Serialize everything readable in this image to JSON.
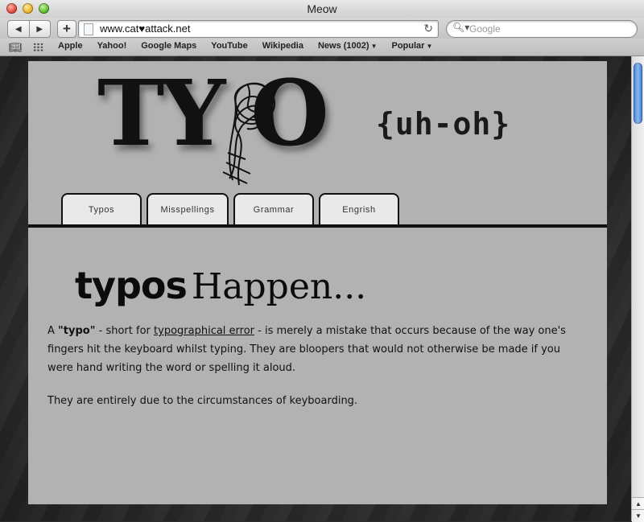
{
  "window": {
    "title": "Meow"
  },
  "toolbar": {
    "back_icon": "back-arrow-icon",
    "forward_icon": "forward-arrow-icon",
    "add_label": "+",
    "url": "www.cat♥attack.net",
    "search_placeholder": "Google"
  },
  "bookmarks": {
    "items": [
      {
        "label": "Apple"
      },
      {
        "label": "Yahoo!"
      },
      {
        "label": "Google Maps"
      },
      {
        "label": "YouTube"
      },
      {
        "label": "Wikipedia"
      },
      {
        "label": "News (1002)"
      },
      {
        "label": "Popular"
      }
    ]
  },
  "header": {
    "logo_text": "TY O",
    "tagline": "{uh-oh}"
  },
  "tabs": [
    {
      "label": "Typos"
    },
    {
      "label": "Misspellings"
    },
    {
      "label": "Grammar"
    },
    {
      "label": "Engrish"
    }
  ],
  "headline": {
    "part1": "typos",
    "part2": "Happen..."
  },
  "content": {
    "p1_a": "A ",
    "p1_term": "\"typo\"",
    "p1_b": " - short for ",
    "p1_link": "typographical error",
    "p1_c": " - is merely a mistake that occurs because of the way one's fingers hit the keyboard whilst typing. They are bloopers that would not otherwise be made if you were hand writing the word or spelling it aloud.",
    "p2": "They are entirely due to the circumstances of keyboarding."
  }
}
